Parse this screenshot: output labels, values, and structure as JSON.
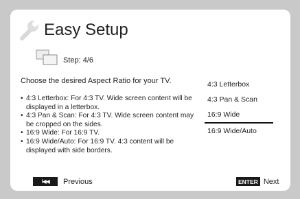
{
  "header": {
    "title": "Easy Setup"
  },
  "step": {
    "label": "Step: 4/6"
  },
  "prompt": "Choose the desired Aspect Ratio for your TV.",
  "descriptions": [
    "4:3 Letterbox: For 4:3 TV.  Wide screen content will be displayed in a letterbox.",
    "4:3 Pan & Scan: For 4:3 TV.  Wide screen content may be cropped on the sides.",
    "16:9 Wide: For 16:9 TV.",
    "16:9 Wide/Auto: For 16:9 TV.  4:3 content will be displayed with side borders."
  ],
  "options": [
    "4:3 Letterbox",
    "4:3 Pan & Scan",
    "16:9 Wide",
    "16:9 Wide/Auto"
  ],
  "selected_option": "16:9 Wide",
  "nav": {
    "prev_key": "I◀◀",
    "prev_label": "Previous",
    "enter_key": "ENTER",
    "next_label": "Next"
  },
  "icons": {
    "header": "wrench-icon",
    "step": "tv-screens-icon"
  }
}
